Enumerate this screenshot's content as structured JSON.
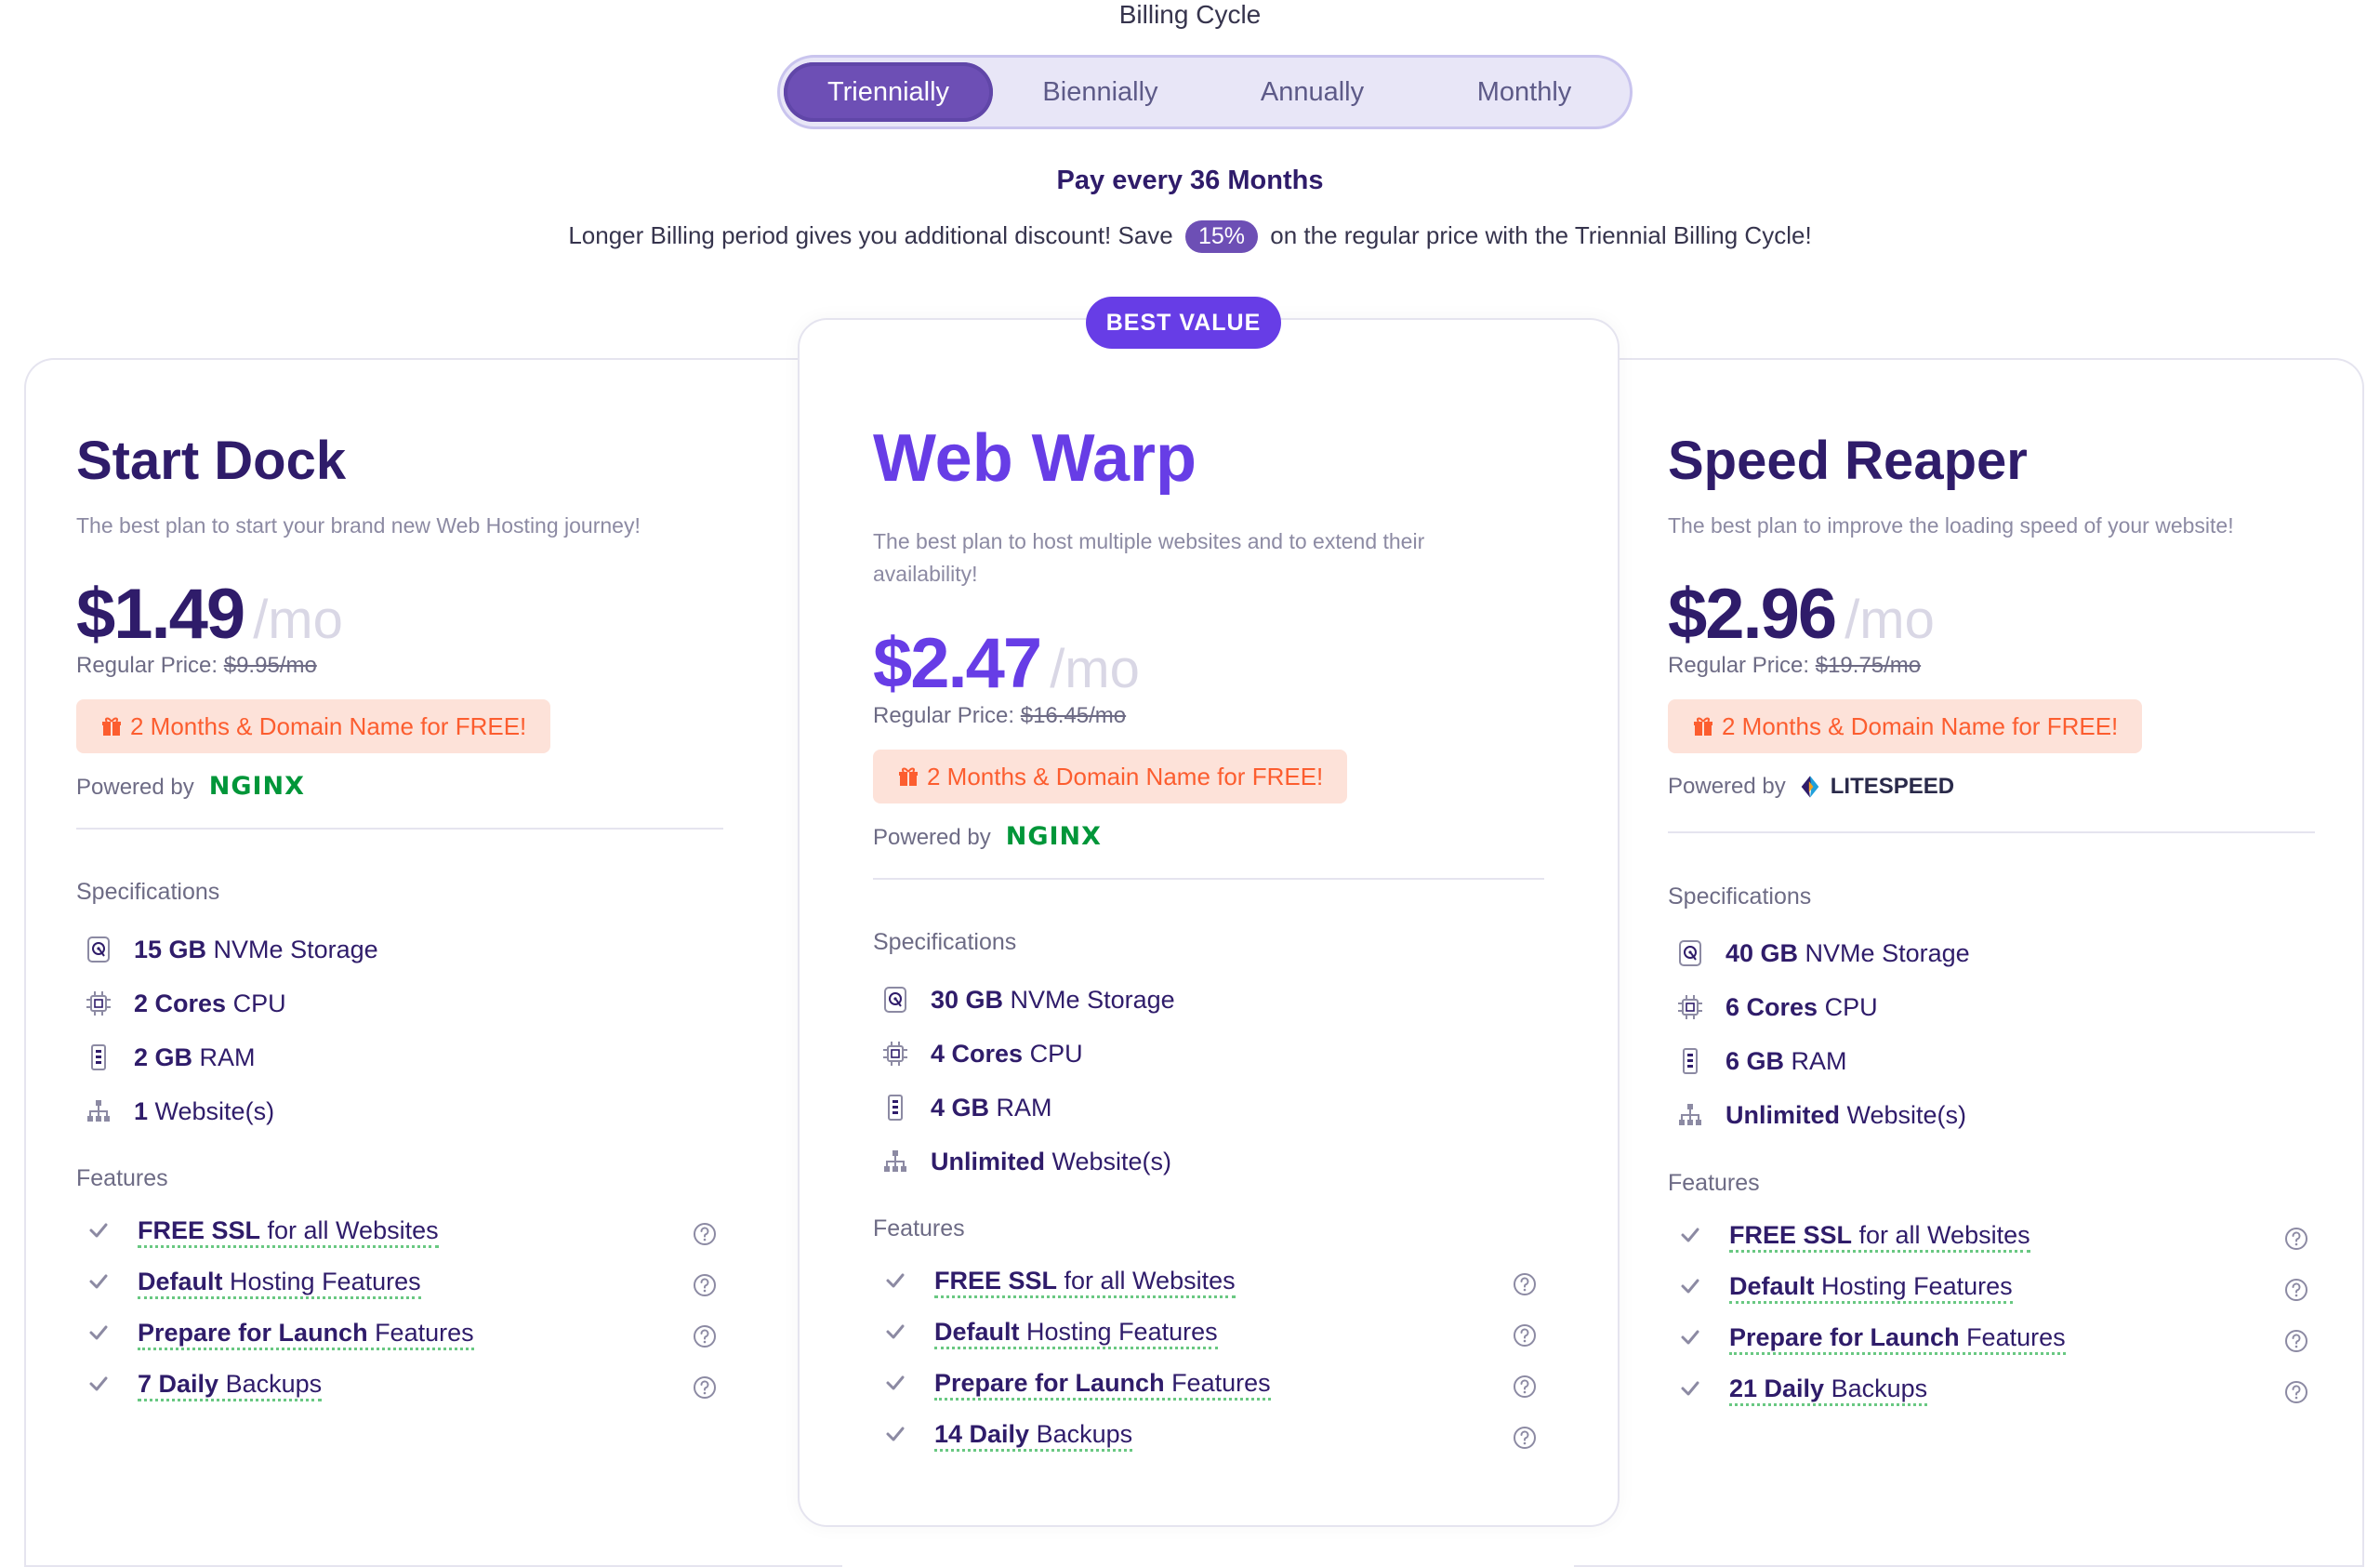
{
  "billing": {
    "title": "Billing Cycle",
    "options": [
      "Triennially",
      "Biennially",
      "Annually",
      "Monthly"
    ],
    "selected": "Triennially",
    "pay_every": "Pay every 36 Months",
    "discount_before": "Longer Billing period gives you additional discount! Save",
    "discount_pct": "15%",
    "discount_after": "on the regular price with the Triennial Billing Cycle!"
  },
  "badge": "BEST VALUE",
  "labels": {
    "per_month": "/mo",
    "regular_price": "Regular Price:",
    "powered_by": "Powered by",
    "specifications": "Specifications",
    "features": "Features"
  },
  "colors": {
    "accent": "#673de6",
    "brand_dark": "#2f1c6a",
    "promo_bg": "#fde2d9",
    "promo_text": "#fc5d2f",
    "nginx_green": "#009639"
  },
  "plans": [
    {
      "name": "Start Dock",
      "description": "The best plan to start your brand new Web Hosting journey!",
      "price": "$1.49",
      "regular": "$9.95/mo",
      "promo": "2 Months & Domain Name for FREE!",
      "powered_logo": "NGINX",
      "specs": [
        {
          "icon": "storage-icon",
          "bold": "15 GB",
          "rest": " NVMe Storage"
        },
        {
          "icon": "cpu-icon",
          "bold": "2 Cores",
          "rest": " CPU"
        },
        {
          "icon": "ram-icon",
          "bold": "2 GB",
          "rest": " RAM"
        },
        {
          "icon": "website-icon",
          "bold": "1",
          "rest": " Website(s)"
        }
      ],
      "features": [
        {
          "bold": "FREE SSL",
          "rest": " for all Websites"
        },
        {
          "bold": "Default",
          "rest": " Hosting Features"
        },
        {
          "bold": "Prepare for Launch",
          "rest": " Features"
        },
        {
          "bold": "7 Daily",
          "rest": " Backups"
        }
      ]
    },
    {
      "name": "Web Warp",
      "description": "The best plan to host multiple websites and to extend their availability!",
      "price": "$2.47",
      "regular": "$16.45/mo",
      "promo": "2 Months & Domain Name for FREE!",
      "powered_logo": "NGINX",
      "specs": [
        {
          "icon": "storage-icon",
          "bold": "30 GB",
          "rest": " NVMe Storage"
        },
        {
          "icon": "cpu-icon",
          "bold": "4 Cores",
          "rest": " CPU"
        },
        {
          "icon": "ram-icon",
          "bold": "4 GB",
          "rest": " RAM"
        },
        {
          "icon": "website-icon",
          "bold": "Unlimited",
          "rest": " Website(s)"
        }
      ],
      "features": [
        {
          "bold": "FREE SSL",
          "rest": " for all Websites"
        },
        {
          "bold": "Default",
          "rest": " Hosting Features"
        },
        {
          "bold": "Prepare for Launch",
          "rest": " Features"
        },
        {
          "bold": "14 Daily",
          "rest": " Backups"
        }
      ]
    },
    {
      "name": "Speed Reaper",
      "description": "The best plan to improve the loading speed of your website!",
      "price": "$2.96",
      "regular": "$19.75/mo",
      "promo": "2 Months & Domain Name for FREE!",
      "powered_logo": "LITESPEED",
      "specs": [
        {
          "icon": "storage-icon",
          "bold": "40 GB",
          "rest": " NVMe Storage"
        },
        {
          "icon": "cpu-icon",
          "bold": "6 Cores",
          "rest": " CPU"
        },
        {
          "icon": "ram-icon",
          "bold": "6 GB",
          "rest": " RAM"
        },
        {
          "icon": "website-icon",
          "bold": "Unlimited",
          "rest": " Website(s)"
        }
      ],
      "features": [
        {
          "bold": "FREE SSL",
          "rest": " for all Websites"
        },
        {
          "bold": "Default",
          "rest": " Hosting Features"
        },
        {
          "bold": "Prepare for Launch",
          "rest": " Features"
        },
        {
          "bold": "21 Daily",
          "rest": " Backups"
        }
      ]
    }
  ]
}
